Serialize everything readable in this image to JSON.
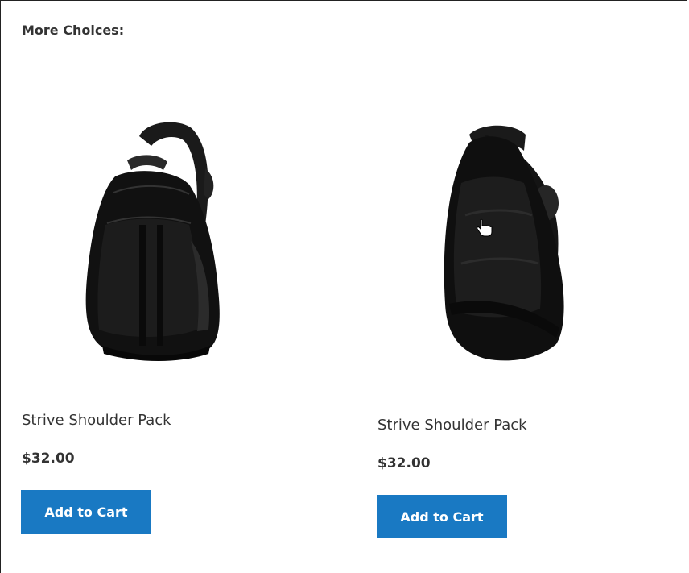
{
  "section": {
    "heading": "More Choices:"
  },
  "products": [
    {
      "name": "Strive Shoulder Pack",
      "price": "$32.00",
      "button_label": "Add to Cart",
      "image_icon": "backpack-front-image"
    },
    {
      "name": "Strive Shoulder Pack",
      "price": "$32.00",
      "button_label": "Add to Cart",
      "image_icon": "backpack-back-image"
    }
  ],
  "colors": {
    "button_bg": "#1979c3",
    "button_text": "#ffffff",
    "text": "#333333"
  }
}
